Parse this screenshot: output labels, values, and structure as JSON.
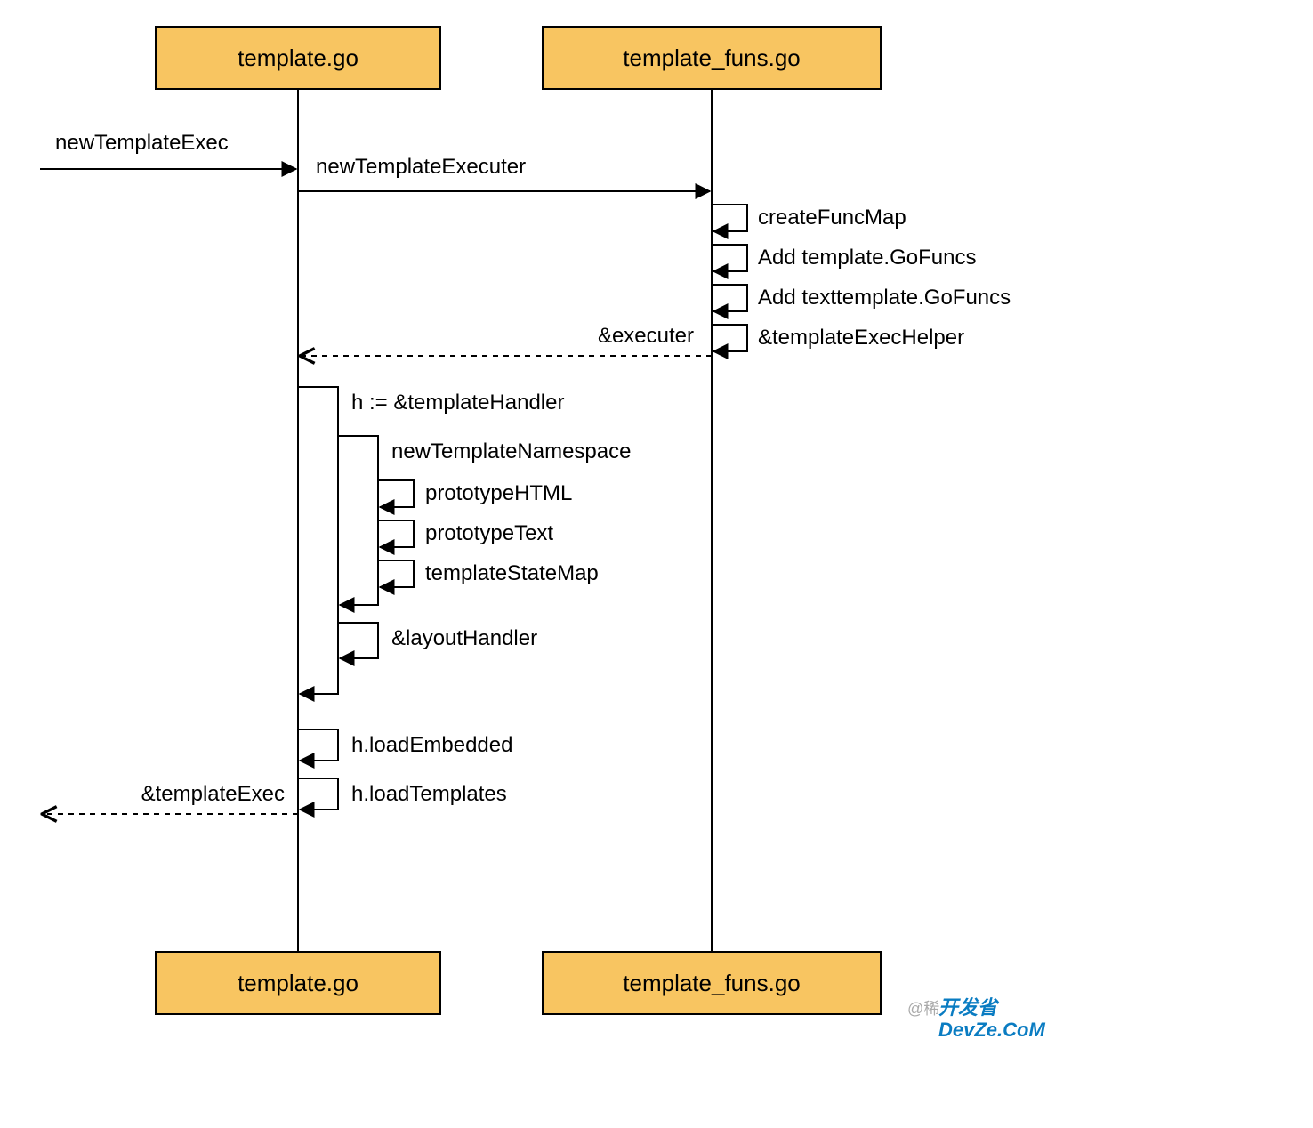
{
  "chart_data": {
    "type": "sequence-diagram",
    "participants": [
      {
        "id": "templateGo",
        "label": "template.go"
      },
      {
        "id": "templateFunsGo",
        "label": "template_funs.go"
      }
    ],
    "messages": [
      {
        "from": "external",
        "to": "templateGo",
        "label": "newTemplateExec",
        "kind": "call"
      },
      {
        "from": "templateGo",
        "to": "templateFunsGo",
        "label": "newTemplateExecuter",
        "kind": "call"
      },
      {
        "from": "templateFunsGo",
        "to": "templateFunsGo",
        "label": "createFuncMap",
        "kind": "self"
      },
      {
        "from": "templateFunsGo",
        "to": "templateFunsGo",
        "label": "Add template.GoFuncs",
        "kind": "self"
      },
      {
        "from": "templateFunsGo",
        "to": "templateFunsGo",
        "label": "Add texttemplate.GoFuncs",
        "kind": "self"
      },
      {
        "from": "templateFunsGo",
        "to": "templateFunsGo",
        "label": "&templateExecHelper",
        "kind": "self"
      },
      {
        "from": "templateFunsGo",
        "to": "templateGo",
        "label": "&executer",
        "kind": "return"
      },
      {
        "from": "templateGo",
        "to": "templateGo",
        "label": "h := &templateHandler",
        "kind": "self-open",
        "depth": 0
      },
      {
        "from": "templateGo",
        "to": "templateGo",
        "label": "newTemplateNamespace",
        "kind": "self-open",
        "depth": 1
      },
      {
        "from": "templateGo",
        "to": "templateGo",
        "label": "prototypeHTML",
        "kind": "self",
        "depth": 2
      },
      {
        "from": "templateGo",
        "to": "templateGo",
        "label": "prototypeText",
        "kind": "self",
        "depth": 2
      },
      {
        "from": "templateGo",
        "to": "templateGo",
        "label": "templateStateMap",
        "kind": "self",
        "depth": 2
      },
      {
        "from": "templateGo",
        "to": "templateGo",
        "label": "",
        "kind": "self-close",
        "depth": 1
      },
      {
        "from": "templateGo",
        "to": "templateGo",
        "label": "&layoutHandler",
        "kind": "self",
        "depth": 1
      },
      {
        "from": "templateGo",
        "to": "templateGo",
        "label": "",
        "kind": "self-close",
        "depth": 0
      },
      {
        "from": "templateGo",
        "to": "templateGo",
        "label": "h.loadEmbedded",
        "kind": "self"
      },
      {
        "from": "templateGo",
        "to": "templateGo",
        "label": "h.loadTemplates",
        "kind": "self"
      },
      {
        "from": "templateGo",
        "to": "external",
        "label": "&templateExec",
        "kind": "return"
      }
    ]
  },
  "watermark": {
    "line1": "@稀",
    "line2a": "开发省",
    "line2b": "DevZe.CoM"
  },
  "labels": {
    "p0_top": "template.go",
    "p1_top": "template_funs.go",
    "p0_bot": "template.go",
    "p1_bot": "template_funs.go",
    "ext_in": "newTemplateExec",
    "m1": "newTemplateExecuter",
    "s1": "createFuncMap",
    "s2": "Add template.GoFuncs",
    "s3": "Add texttemplate.GoFuncs",
    "s4": "&templateExecHelper",
    "ret1": "&executer",
    "n1": "h := &templateHandler",
    "n2": "newTemplateNamespace",
    "n3": "prototypeHTML",
    "n4": "prototypeText",
    "n5": "templateStateMap",
    "n6": "&layoutHandler",
    "n7": "h.loadEmbedded",
    "n8": "h.loadTemplates",
    "ret2": "&templateExec"
  }
}
